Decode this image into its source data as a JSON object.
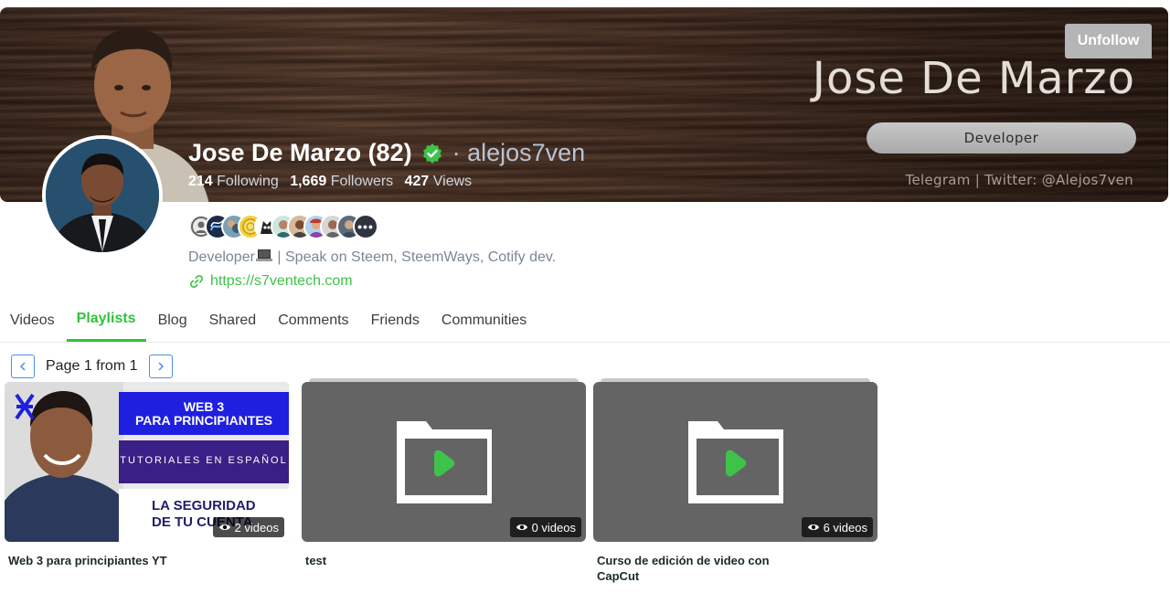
{
  "cover": {
    "name": "Jose De Marzo",
    "role": "Developer",
    "contact": "Telegram | Twitter: @Alejos7ven"
  },
  "unfollow_label": "Unfollow",
  "profile": {
    "name": "Jose De Marzo (82)",
    "handle": "· alejos7ven",
    "following_count": "214",
    "following_label": "Following",
    "followers_count": "1,669",
    "followers_label": "Followers",
    "views_count": "427",
    "views_label": "Views",
    "bio_prefix": "Developer",
    "bio_suffix": "| Speak on Steem, SteemWays, Cotify dev.",
    "website": "https://s7ventech.com"
  },
  "community_icons": [
    "person-icon",
    "steem-icon",
    "community-icon",
    "coin-icon",
    "owl-icon",
    "avatar-icon",
    "avatar-icon",
    "avatar-icon",
    "avatar-icon",
    "avatar-icon",
    "more-icon"
  ],
  "tabs": [
    "Videos",
    "Playlists",
    "Blog",
    "Shared",
    "Comments",
    "Friends",
    "Communities"
  ],
  "active_tab": "Playlists",
  "pager": {
    "text": "Page 1 from 1"
  },
  "playlists": [
    {
      "title": "Web 3 para principiantes YT",
      "count": "2 videos",
      "thumb_lines": [
        "WEB 3",
        "PARA PRINCIPIANTES",
        "TUTORIALES EN ESPAÑOL",
        "LA SEGURIDAD",
        "DE TU CUENTA"
      ]
    },
    {
      "title": "test",
      "count": "0 videos"
    },
    {
      "title": "Curso de edición de video con CapCut",
      "count": "6 videos"
    }
  ],
  "colors": {
    "accent_green": "#2fc43b",
    "link_blue": "#4a90e2"
  }
}
